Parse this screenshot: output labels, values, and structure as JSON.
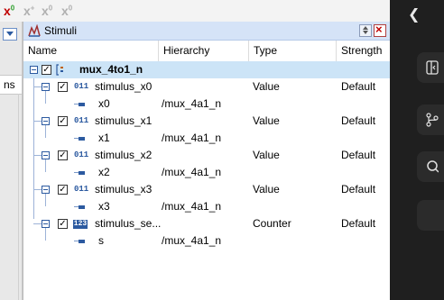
{
  "toolbar": {
    "icons": [
      "x-force-add",
      "x-force-plus",
      "x-force-clock",
      "x-force-clear"
    ],
    "first": {
      "letter": "x",
      "sup": "0"
    },
    "second": {
      "letter": "x",
      "sup": "+"
    },
    "third": {
      "letter": "x",
      "sup": "0"
    },
    "fourth": {
      "letter": "x",
      "sup": "0"
    }
  },
  "left_pane": {
    "unit_label": "ns"
  },
  "panel": {
    "title": "Stimuli",
    "columns": [
      "Name",
      "Hierarchy",
      "Type",
      "Strength"
    ]
  },
  "tree": {
    "root": {
      "name": "mux_4to1_n",
      "checked": true
    },
    "stimuli": [
      {
        "name": "stimulus_x0",
        "type": "Value",
        "strength": "Default",
        "icon": "011",
        "signal": {
          "name": "x0",
          "hierarchy": "/mux_4a1_n"
        }
      },
      {
        "name": "stimulus_x1",
        "type": "Value",
        "strength": "Default",
        "icon": "011",
        "signal": {
          "name": "x1",
          "hierarchy": "/mux_4a1_n"
        }
      },
      {
        "name": "stimulus_x2",
        "type": "Value",
        "strength": "Default",
        "icon": "011",
        "signal": {
          "name": "x2",
          "hierarchy": "/mux_4a1_n"
        }
      },
      {
        "name": "stimulus_x3",
        "type": "Value",
        "strength": "Default",
        "icon": "011",
        "signal": {
          "name": "x3",
          "hierarchy": "/mux_4a1_n"
        }
      },
      {
        "name": "stimulus_se...",
        "type": "Counter",
        "strength": "Default",
        "icon": "123",
        "signal": {
          "name": "s",
          "hierarchy": "/mux_4a1_n"
        }
      }
    ]
  },
  "sidebar_dark": {
    "icons": [
      "back-arrow-icon",
      "panel-toggle-icon",
      "source-control-icon",
      "search-icon"
    ]
  },
  "colors": {
    "title_bar": "#d5e3f7",
    "root_row": "#cce4f7",
    "accent": "#2c5aa0",
    "dark_bg": "#1f1f1f"
  }
}
